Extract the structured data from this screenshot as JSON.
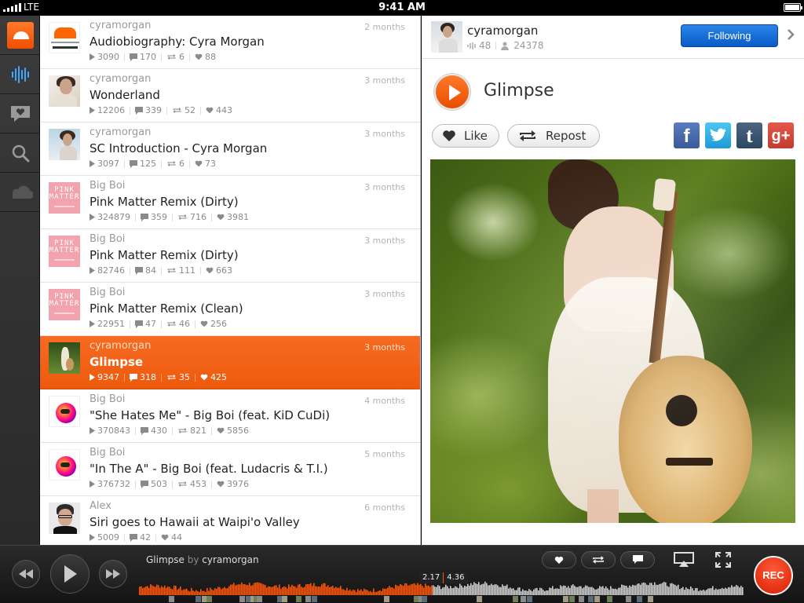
{
  "status_bar": {
    "carrier": "LTE",
    "time": "9:41 AM"
  },
  "nav": {
    "items": [
      "soundcloud-logo",
      "stream-wave-icon",
      "activity-heart-icon",
      "search-icon",
      "cloud-icon"
    ]
  },
  "tracks": [
    {
      "artist": "cyramorgan",
      "title": "Audiobiography: Cyra Morgan",
      "age": "2 months",
      "plays": "3090",
      "comments": "170",
      "reposts": "6",
      "likes": "88",
      "thumb": "audio"
    },
    {
      "artist": "cyramorgan",
      "title": "Wonderland",
      "age": "3 months",
      "plays": "12206",
      "comments": "339",
      "reposts": "52",
      "likes": "443",
      "thumb": "portrait"
    },
    {
      "artist": "cyramorgan",
      "title": "SC Introduction - Cyra Morgan",
      "age": "3 months",
      "plays": "3097",
      "comments": "125",
      "reposts": "6",
      "likes": "73",
      "thumb": "sky"
    },
    {
      "artist": "Big Boi",
      "title": "Pink Matter Remix (Dirty)",
      "age": "3 months",
      "plays": "324879",
      "comments": "359",
      "reposts": "716",
      "likes": "3981",
      "thumb": "pink"
    },
    {
      "artist": "Big Boi",
      "title": "Pink Matter Remix (Dirty)",
      "age": "3 months",
      "plays": "82746",
      "comments": "84",
      "reposts": "111",
      "likes": "663",
      "thumb": "pink"
    },
    {
      "artist": "Big Boi",
      "title": "Pink Matter Remix (Clean)",
      "age": "3 months",
      "plays": "22951",
      "comments": "47",
      "reposts": "46",
      "likes": "256",
      "thumb": "pink"
    },
    {
      "artist": "cyramorgan",
      "title": "Glimpse",
      "age": "3 months",
      "plays": "9347",
      "comments": "318",
      "reposts": "35",
      "likes": "425",
      "thumb": "glimpse",
      "selected": true
    },
    {
      "artist": "Big Boi",
      "title": "\"She Hates Me\" - Big Boi (feat. KiD CuDi)",
      "age": "4 months",
      "plays": "370843",
      "comments": "430",
      "reposts": "821",
      "likes": "5856",
      "thumb": "bigboi"
    },
    {
      "artist": "Big Boi",
      "title": "\"In The A\" - Big Boi (feat. Ludacris & T.I.)",
      "age": "5 months",
      "plays": "376732",
      "comments": "503",
      "reposts": "453",
      "likes": "3976",
      "thumb": "bigboi"
    },
    {
      "artist": "Alex",
      "title": "Siri goes to Hawaii at Waipi'o Valley",
      "age": "6 months",
      "plays": "5009",
      "comments": "42",
      "reposts": "",
      "likes": "44",
      "thumb": "alex"
    }
  ],
  "pink_thumb_text": "PINK MATTER",
  "detail": {
    "username": "cyramorgan",
    "tracks_count": "48",
    "followers_count": "24378",
    "following_label": "Following",
    "track_title": "Glimpse",
    "like_label": "Like",
    "repost_label": "Repost",
    "social": {
      "facebook": "f",
      "tumblr": "t",
      "google": "g+"
    }
  },
  "player": {
    "track": "Glimpse",
    "by": "by",
    "artist": "cyramorgan",
    "elapsed": "2.17",
    "duration": "4.36",
    "progress_fraction": 0.4845,
    "rec_label": "REC"
  },
  "colors": {
    "accent": "#ff5500",
    "following_blue": "#0a5bc6",
    "rec_red": "#d81e00"
  }
}
